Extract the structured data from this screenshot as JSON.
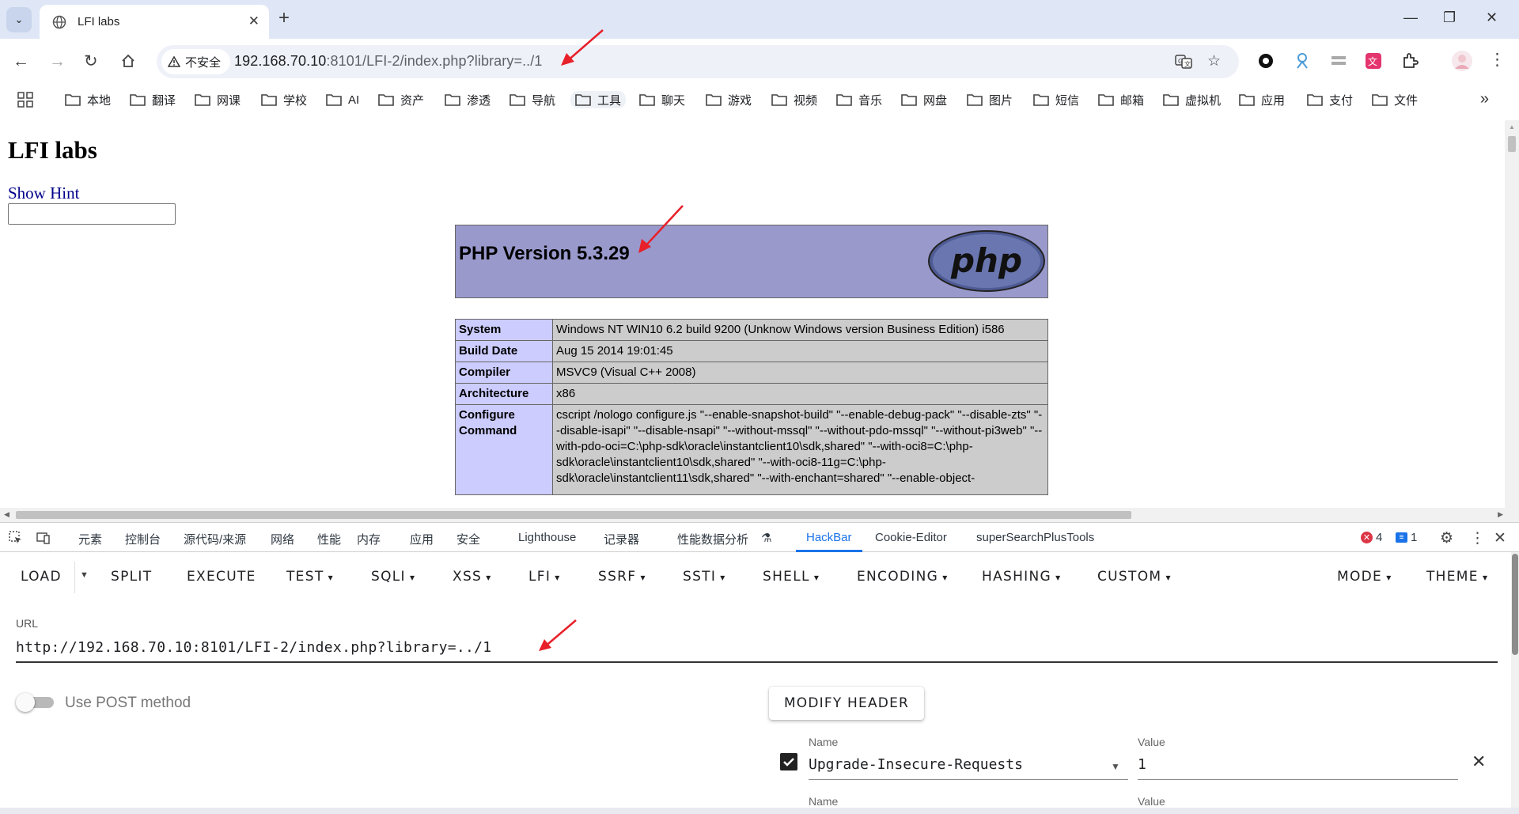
{
  "browser": {
    "tab_title": "LFI labs",
    "omnibox": {
      "security_label": "不安全",
      "url_host": "192.168.70.10",
      "url_rest": ":8101/LFI-2/index.php?library=../1"
    },
    "bookmarks": [
      "本地",
      "翻译",
      "网课",
      "学校",
      "AI",
      "资产",
      "渗透",
      "导航",
      "工具",
      "聊天",
      "游戏",
      "视频",
      "音乐",
      "网盘",
      "图片",
      "短信",
      "邮箱",
      "虚拟机",
      "应用",
      "支付",
      "文件"
    ],
    "active_bookmark": "工具"
  },
  "page": {
    "heading": "LFI labs",
    "hint_link": "Show Hint",
    "php_version": "PHP Version 5.3.29",
    "php_logo_text": "php",
    "info_rows": [
      {
        "key": "System",
        "value": "Windows NT WIN10 6.2 build 9200 (Unknow Windows version Business Edition) i586"
      },
      {
        "key": "Build Date",
        "value": "Aug 15 2014 19:01:45"
      },
      {
        "key": "Compiler",
        "value": "MSVC9 (Visual C++ 2008)"
      },
      {
        "key": "Architecture",
        "value": "x86"
      },
      {
        "key": "Configure Command",
        "value": "cscript /nologo configure.js \"--enable-snapshot-build\" \"--enable-debug-pack\" \"--disable-zts\" \"--disable-isapi\" \"--disable-nsapi\" \"--without-mssql\" \"--without-pdo-mssql\" \"--without-pi3web\" \"--with-pdo-oci=C:\\php-sdk\\oracle\\instantclient10\\sdk,shared\" \"--with-oci8=C:\\php-sdk\\oracle\\instantclient10\\sdk,shared\" \"--with-oci8-11g=C:\\php-sdk\\oracle\\instantclient11\\sdk,shared\" \"--with-enchant=shared\" \"--enable-object-"
      }
    ]
  },
  "devtools": {
    "tabs": [
      "元素",
      "控制台",
      "源代码/来源",
      "网络",
      "性能",
      "内存",
      "应用",
      "安全",
      "Lighthouse",
      "记录器",
      "性能数据分析",
      "HackBar",
      "Cookie-Editor",
      "superSearchPlusTools"
    ],
    "active_tab": "HackBar",
    "error_count": "4",
    "message_count": "1"
  },
  "hackbar": {
    "menu": [
      "LOAD",
      "SPLIT",
      "EXECUTE",
      "TEST",
      "SQLI",
      "XSS",
      "LFI",
      "SSRF",
      "SSTI",
      "SHELL",
      "ENCODING",
      "HASHING",
      "CUSTOM",
      "MODE",
      "THEME"
    ],
    "url_label": "URL",
    "url_value": "http://192.168.70.10:8101/LFI-2/index.php?library=../1",
    "post_label": "Use POST method",
    "post_enabled": false,
    "modify_header_label": "MODIFY HEADER",
    "headers": [
      {
        "checked": true,
        "name_label": "Name",
        "name": "Upgrade-Insecure-Requests",
        "value_label": "Value",
        "value": "1"
      },
      {
        "name_label": "Name",
        "value_label": "Value"
      }
    ]
  },
  "colors": {
    "accent": "#1a73e8",
    "php_header": "#9999cc",
    "php_key": "#ccccff",
    "php_value": "#cccccc",
    "annotation_arrow": "#e8202a"
  }
}
